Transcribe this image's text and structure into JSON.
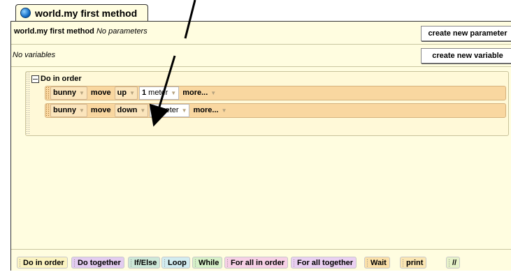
{
  "tab": {
    "title": "world.my first method"
  },
  "method": {
    "name": "world.my first method",
    "params_note": "No parameters",
    "create_param_label": "create new parameter",
    "vars_note": "No variables",
    "create_var_label": "create new variable"
  },
  "code": {
    "block_label": "Do in order",
    "statements": [
      {
        "object": "bunny",
        "method": "move",
        "direction": "up",
        "amount_num": "1",
        "amount_unit": "meter",
        "more": "more..."
      },
      {
        "object": "bunny",
        "method": "move",
        "direction": "down",
        "amount_num": "1",
        "amount_unit": "meter",
        "more": "more..."
      }
    ]
  },
  "palette": [
    {
      "label": "Do in order",
      "color": "#fbf3c0"
    },
    {
      "label": "Do together",
      "color": "#e3ccf0"
    },
    {
      "label": "If/Else",
      "color": "#cde8d8"
    },
    {
      "label": "Loop",
      "color": "#d2ecf0"
    },
    {
      "label": "While",
      "color": "#d6f0c8"
    },
    {
      "label": "For all in order",
      "color": "#f7d0e6"
    },
    {
      "label": "For all together",
      "color": "#ead0f2"
    },
    {
      "label": "Wait",
      "color": "#fbe0a8"
    },
    {
      "label": "print",
      "color": "#fbe6b2"
    },
    {
      "label": "//",
      "color": "#e6f2c8"
    }
  ]
}
